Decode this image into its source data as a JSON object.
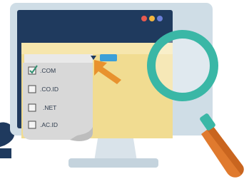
{
  "illustration": {
    "subject": "domain-search-illustration",
    "colors": {
      "monitor_bezel": "#cfdde6",
      "screen_frame": "#1f3a5e",
      "screen_content": "#f1dc91",
      "list_panel": "#d8d8d8",
      "magnifier_ring": "#3ab7a6",
      "magnifier_handle": "#e07a2e",
      "cursor": "#e8922e",
      "accent_button": "#3c9fd8"
    },
    "window_dots": [
      "#e85a4f",
      "#f3b63f",
      "#6b7fd8"
    ]
  },
  "domain_list": {
    "options": [
      {
        "label": ".COM",
        "checked": true
      },
      {
        "label": ".CO.ID",
        "checked": false
      },
      {
        "label": ".NET",
        "checked": false
      },
      {
        "label": ".AC.ID",
        "checked": false
      }
    ]
  }
}
